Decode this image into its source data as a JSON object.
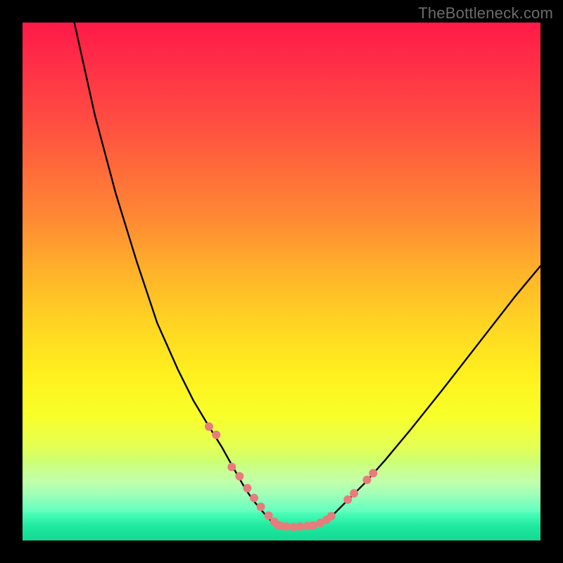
{
  "attribution": "TheBottleneck.com",
  "chart_data": {
    "type": "line",
    "title": "",
    "xlabel": "",
    "ylabel": "",
    "xlim": [
      0,
      100
    ],
    "ylim": [
      0,
      100
    ],
    "grid": false,
    "legend": false,
    "series": [
      {
        "name": "bottleneck-curve-left",
        "x": [
          10,
          14,
          18,
          22,
          26,
          30,
          33,
          36,
          38.5,
          41,
          43,
          44.5,
          46,
          47.2,
          48.2,
          49,
          49.5
        ],
        "y": [
          100,
          82,
          67,
          54,
          42,
          33,
          27,
          22,
          18,
          13.5,
          10,
          7.8,
          6,
          4.6,
          3.6,
          3,
          2.8
        ],
        "stroke": "#000000",
        "stroke_width": 2.4
      },
      {
        "name": "bottleneck-curve-bottom",
        "x": [
          49.5,
          51,
          53,
          55,
          56.5
        ],
        "y": [
          2.8,
          2.6,
          2.6,
          2.7,
          2.9
        ],
        "stroke": "#000000",
        "stroke_width": 2.4
      },
      {
        "name": "bottleneck-curve-right",
        "x": [
          56.5,
          58,
          60,
          62.5,
          66,
          70,
          75,
          81,
          88,
          95,
          100
        ],
        "y": [
          2.9,
          3.6,
          5,
          7.5,
          11,
          15.5,
          21.5,
          29,
          38,
          47,
          53
        ],
        "stroke": "#000000",
        "stroke_width": 2.4
      },
      {
        "name": "markers-left-arm",
        "marker_only": true,
        "marker_color": "#e77c7c",
        "marker_radius": 6,
        "x": [
          36.0,
          37.4,
          40.4,
          41.9,
          43.4,
          44.7,
          46.0,
          47.5,
          48.6,
          49.3
        ],
        "y": [
          22.0,
          20.4,
          14.2,
          12.4,
          10.1,
          8.2,
          6.5,
          4.8,
          3.6,
          3.0
        ]
      },
      {
        "name": "markers-bottom-flat",
        "marker_only": true,
        "marker_color": "#e77c7c",
        "marker_radius": 6,
        "x": [
          49.8,
          50.9,
          52.3,
          53.6,
          55.0,
          56.1
        ],
        "y": [
          2.8,
          2.7,
          2.6,
          2.7,
          2.8,
          2.9
        ]
      },
      {
        "name": "markers-right-arm",
        "marker_only": true,
        "marker_color": "#e77c7c",
        "marker_radius": 6,
        "x": [
          57.5,
          58.7,
          59.6,
          62.8,
          64.0,
          66.5,
          67.7
        ],
        "y": [
          3.4,
          4.0,
          4.7,
          7.9,
          9.1,
          11.7,
          13.0
        ]
      }
    ]
  }
}
